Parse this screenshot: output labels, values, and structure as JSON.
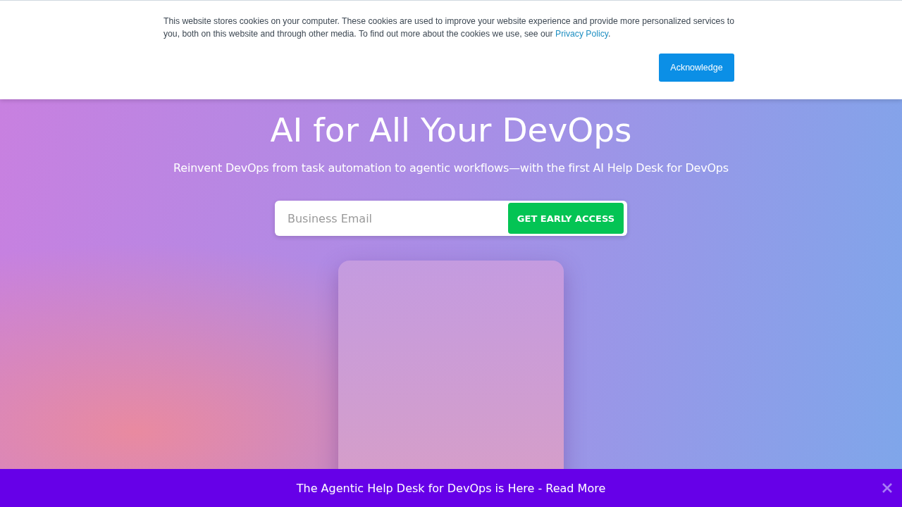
{
  "cookie_banner": {
    "text": "This website stores cookies on your computer. These cookies are used to improve your website experience and provide more personalized services to you, both on this website and through other media. To find out more about the cookies we use, see our",
    "link": "Privacy Policy",
    "text_after": ".",
    "button": "Acknowledge"
  },
  "hero": {
    "title": "AI for All Your DevOps",
    "subtitle": "Reinvent DevOps from task automation to agentic workflows—with the first AI Help Desk for DevOps",
    "email": {
      "placeholder": "Business Email"
    },
    "button": "GET EARLY ACCESS"
  },
  "announcement_bar": {
    "text": "The Agentic Help Desk for DevOps is Here - Read More"
  }
}
